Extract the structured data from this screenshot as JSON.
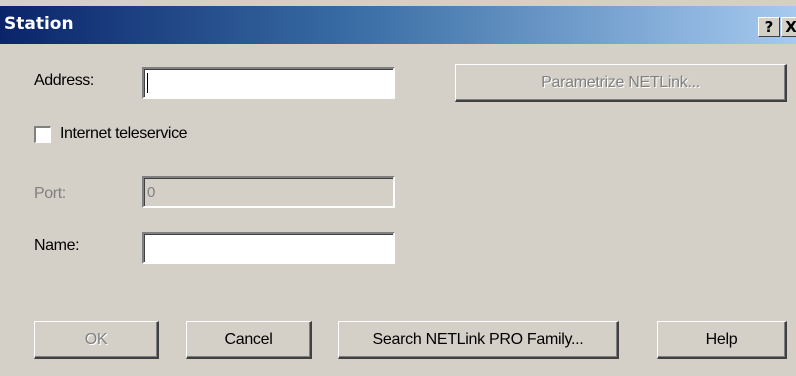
{
  "window": {
    "title": "Station",
    "help_glyph": "?",
    "close_glyph": "X"
  },
  "address": {
    "label": "Address:",
    "value": ""
  },
  "parametrize_button": "Parametrize NETLink...",
  "internet_teleservice": {
    "label": "Internet teleservice",
    "checked": false
  },
  "port": {
    "label": "Port:",
    "value": "0"
  },
  "name": {
    "label": "Name:",
    "value": ""
  },
  "buttons": {
    "ok": "OK",
    "cancel": "Cancel",
    "search": "Search NETLink PRO Family...",
    "help": "Help"
  }
}
